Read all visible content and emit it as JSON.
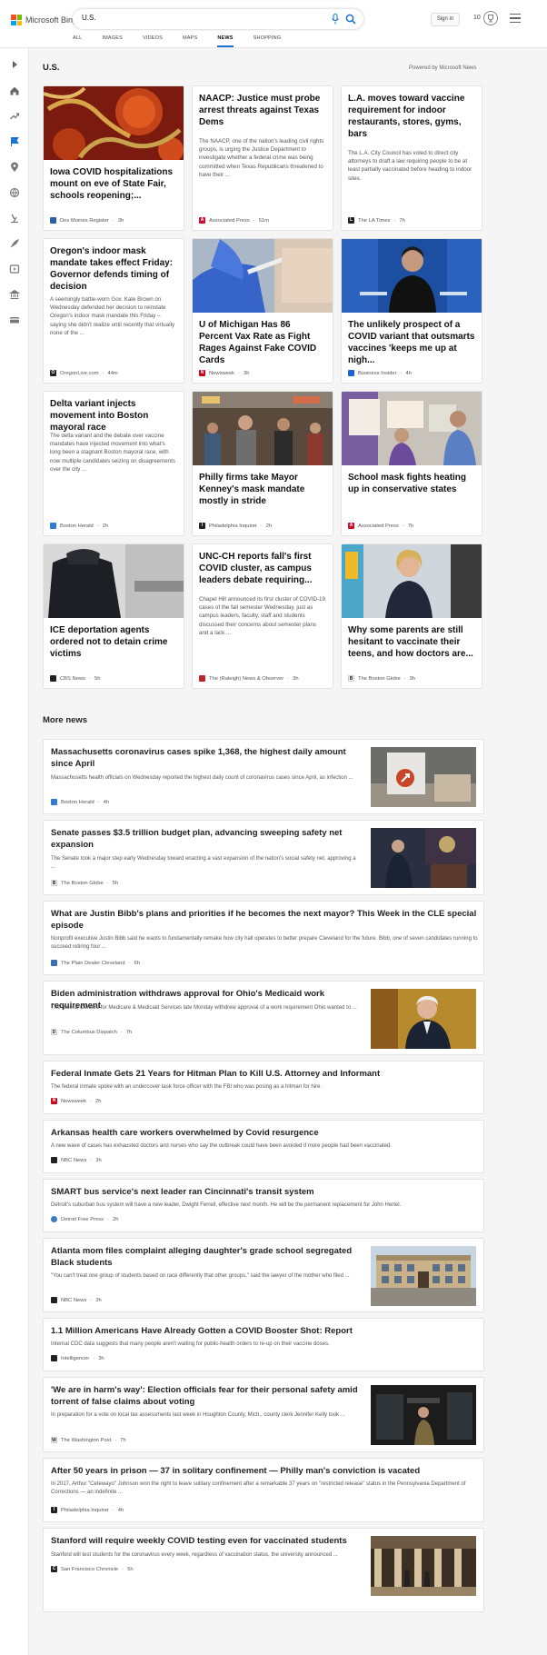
{
  "header": {
    "logo_text": "Microsoft Bing",
    "search_query": "U.S.",
    "signin_label": "Sign in",
    "rewards_count": "10",
    "tabs": [
      {
        "label": "ALL"
      },
      {
        "label": "IMAGES"
      },
      {
        "label": "VIDEOS"
      },
      {
        "label": "MAPS"
      },
      {
        "label": "NEWS"
      },
      {
        "label": "SHOPPING"
      }
    ],
    "active_tab": "NEWS"
  },
  "section": {
    "title": "U.S.",
    "powered_by": "Powered by Microsoft News"
  },
  "cards": [
    {
      "title": "Iowa COVID hospitalizations mount on eve of State Fair, schools reopening;...",
      "snippet": "",
      "source": "Des Moines Register",
      "time": "3h",
      "src_color": "#2b5fa8"
    },
    {
      "title": "NAACP: Justice must probe arrest threats against Texas Dems",
      "snippet": "The NAACP, one of the nation's leading civil rights groups, is urging the Justice Department to investigate whether a federal crime was being committed when Texas Republicans threatened to have their ...",
      "source": "Associated Press",
      "time": "51m",
      "src_color": "#c8102e"
    },
    {
      "title": "L.A. moves toward vaccine requirement for indoor restaurants, stores, gyms, bars",
      "snippet": "The L.A. City Council has voted to direct city attorneys to draft a law requiring people to be at least partially vaccinated before heading to indoor sites.",
      "source": "The LA Times",
      "time": "7h",
      "src_color": "#222222"
    },
    {
      "title": "Oregon's indoor mask mandate takes effect Friday: Governor defends timing of decision",
      "snippet": "A seemingly battle-worn Gov. Kate Brown on Wednesday defended her decision to reinstate Oregon's indoor mask mandate this Friday – saying she didn't realize until recently that virtually none of the ...",
      "source": "OregonLive.com",
      "time": "44m",
      "src_color": "#222222"
    },
    {
      "title": "U of Michigan Has 86 Percent Vax Rate as Fight Rages Against Fake COVID Cards",
      "snippet": "",
      "source": "Newsweek",
      "time": "3h",
      "src_color": "#d0021b"
    },
    {
      "title": "The unlikely prospect of a COVID variant that outsmarts vaccines 'keeps me up at nigh...",
      "snippet": "",
      "source": "Business Insider",
      "time": "4h",
      "src_color": "#1a66d6"
    },
    {
      "title": "Delta variant injects movement into Boston mayoral race",
      "snippet": "The delta variant and the debate over vaccine mandates have injected movement into what's long been a stagnant Boston mayoral race, with now multiple candidates seizing on disagreements over the city ...",
      "source": "Boston Herald",
      "time": "2h",
      "src_color": "#2d7dd2"
    },
    {
      "title": "Philly firms take Mayor Kenney's mask mandate mostly in stride",
      "snippet": "",
      "source": "Philadelphia Inquirer",
      "time": "2h",
      "src_color": "#222222"
    },
    {
      "title": "School mask fights heating up in conservative states",
      "snippet": "",
      "source": "Associated Press",
      "time": "7h",
      "src_color": "#c8102e"
    },
    {
      "title": "ICE deportation agents ordered not to detain crime victims",
      "snippet": "",
      "source": "CBS News",
      "time": "5h",
      "src_color": "#222222"
    },
    {
      "title": "UNC-CH reports fall's first COVID cluster, as campus leaders debate requiring...",
      "snippet": "Chapel Hill announced its first cluster of COVID-19 cases of the fall semester Wednesday, just as campus leaders, faculty, staff and students discussed their concerns about semester plans and a lack ...",
      "source": "The (Raleigh) News & Observer",
      "time": "3h",
      "src_color": "#b8262c"
    },
    {
      "title": "Why some parents are still hesitant to vaccinate their teens, and how doctors are...",
      "snippet": "",
      "source": "The Boston Globe",
      "time": "3h",
      "src_color": "#ffffff"
    }
  ],
  "more_news": {
    "title": "More news",
    "items": [
      {
        "title": "Massachusetts coronavirus cases spike 1,368, the highest daily amount since April",
        "snippet": "Massachusetts health officials on Wednesday reported the highest daily count of coronavirus cases since April, as infection ...",
        "source": "Boston Herald",
        "time": "4h",
        "src_color": "#2d7dd2"
      },
      {
        "title": "Senate passes $3.5 trillion budget plan, advancing sweeping safety net expansion",
        "snippet": "The Senate took a major step early Wednesday toward enacting a vast expansion of the nation's social safety net, approving a ...",
        "source": "The Boston Globe",
        "time": "5h",
        "src_color": "#ffffff"
      },
      {
        "title": "What are Justin Bibb's plans and priorities if he becomes the next mayor? This Week in the CLE special episode",
        "snippet": "Nonprofit executive Justin Bibb said he wants to fundamentally remake how city hall operates to better prepare Cleveland for the future. Bibb, one of seven candidates running to succeed retiring four ...",
        "source": "The Plain Dealer Cleveland",
        "time": "6h",
        "src_color": "#3a6fb0"
      },
      {
        "title": "Biden administration withdraws approval for Ohio's Medicaid work requirement",
        "snippet": "The federal Centers for Medicare & Medicaid Services late Monday withdrew approval of a work requirement Ohio wanted to ...",
        "source": "The Columbus Dispatch",
        "time": "7h",
        "src_color": "#ffffff"
      },
      {
        "title": "Federal Inmate Gets 21 Years for Hitman Plan to Kill U.S. Attorney and Informant",
        "snippet": "The federal inmate spoke with an undercover task force officer with the FBI who was posing as a hitman for hire.",
        "source": "Newsweek",
        "time": "2h",
        "src_color": "#d0021b"
      },
      {
        "title": "Arkansas health care workers overwhelmed by Covid resurgence",
        "snippet": "A new wave of cases has exhausted doctors and nurses who say the outbreak could have been avoided if more people had been vaccinated.",
        "source": "NBC News",
        "time": "3h",
        "src_color": "#222222"
      },
      {
        "title": "SMART bus service's next leader ran Cincinnati's transit system",
        "snippet": "Detroit's suburban bus system will have a new leader, Dwight Ferrell, effective next month. He will be the permanent replacement for John Hertel.",
        "source": "Detroit Free Press",
        "time": "2h",
        "src_color": "#3b79c2"
      },
      {
        "title": "Atlanta mom files complaint alleging daughter's grade school segregated Black students",
        "snippet": "\"You can't treat one group of students based on race differently that other groups,\" said the lawyer of the mother who filed ...",
        "source": "NBC News",
        "time": "3h",
        "src_color": "#222222"
      },
      {
        "title": "1.1 Million Americans Have Already Gotten a COVID Booster Shot: Report",
        "snippet": "Internal CDC data suggests that many people aren't waiting for public-health orders to re-up on their vaccine doses.",
        "source": "Intelligencer",
        "time": "3h",
        "src_color": "#222222"
      },
      {
        "title": "'We are in harm's way': Election officials fear for their personal safety amid torrent of false claims about voting",
        "snippet": "In preparation for a vote on local tax assessments last week in Houghton County, Mich., county clerk Jennifer Kelly took ...",
        "source": "The Washington Post",
        "time": "7h",
        "src_color": "#ffffff"
      },
      {
        "title": "After 50 years in prison — 37 in solitary confinement — Philly man's conviction is vacated",
        "snippet": "In 2017, Arthur \"Cetewayo\" Johnson won the right to leave solitary confinement after a remarkable 37 years on \"restricted release\" status in the Pennsylvania Department of Corrections — an indefinite ...",
        "source": "Philadelphia Inquirer",
        "time": "4h",
        "src_color": "#222222"
      },
      {
        "title": "Stanford will require weekly COVID testing even for vaccinated students",
        "snippet": "Stanford will test students for the coronavirus every week, regardless of vaccination status, the university announced ...",
        "source": "San Francisco Chronicle",
        "time": "5h",
        "src_color": "#222222"
      }
    ]
  },
  "icons": {
    "rail": [
      "expand-icon",
      "home-icon",
      "trending-icon",
      "flag-icon",
      "location-icon",
      "world-icon",
      "science-icon",
      "technology-icon",
      "entertainment-icon",
      "politics-icon",
      "money-icon"
    ]
  },
  "colors": {
    "accent": "#1a75d2",
    "background": "#f5f5f5"
  }
}
